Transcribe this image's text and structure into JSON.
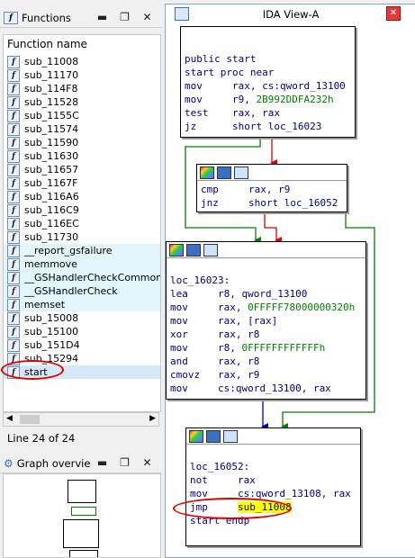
{
  "functions_panel": {
    "title": "Functions",
    "column_header": "Function name",
    "items": [
      {
        "name": "sub_11008",
        "library": false
      },
      {
        "name": "sub_11170",
        "library": false
      },
      {
        "name": "sub_114F8",
        "library": false
      },
      {
        "name": "sub_11528",
        "library": false
      },
      {
        "name": "sub_1155C",
        "library": false
      },
      {
        "name": "sub_11574",
        "library": false
      },
      {
        "name": "sub_11590",
        "library": false
      },
      {
        "name": "sub_11630",
        "library": false
      },
      {
        "name": "sub_11657",
        "library": false
      },
      {
        "name": "sub_1167F",
        "library": false
      },
      {
        "name": "sub_116A6",
        "library": false
      },
      {
        "name": "sub_116C9",
        "library": false
      },
      {
        "name": "sub_116EC",
        "library": false
      },
      {
        "name": "sub_11730",
        "library": false
      },
      {
        "name": "__report_gsfailure",
        "library": true
      },
      {
        "name": "memmove",
        "library": true
      },
      {
        "name": "__GSHandlerCheckCommon",
        "library": true
      },
      {
        "name": "__GSHandlerCheck",
        "library": true
      },
      {
        "name": "memset",
        "library": true
      },
      {
        "name": "sub_15008",
        "library": false
      },
      {
        "name": "sub_15100",
        "library": false
      },
      {
        "name": "sub_151D4",
        "library": false
      },
      {
        "name": "sub_15294",
        "library": false
      },
      {
        "name": "start",
        "library": false,
        "selected": true
      }
    ],
    "status": "Line 24 of 24"
  },
  "graph_overview": {
    "title": "Graph overvie"
  },
  "ida_view": {
    "title": "IDA View-A",
    "blocks": [
      {
        "lines": [
          [
            {
              "t": "public start"
            }
          ],
          [
            {
              "t": "start proc near"
            }
          ],
          [
            {
              "t": "mov     rax, cs:qword_13100"
            }
          ],
          [
            {
              "t": "mov     r9, "
            },
            {
              "t": "2B992DDFA232h",
              "c": "num"
            }
          ],
          [
            {
              "t": "test    rax, rax"
            }
          ],
          [
            {
              "t": "jz      short loc_16023"
            }
          ]
        ]
      },
      {
        "lines": [
          [
            {
              "t": "cmp     rax, r9"
            }
          ],
          [
            {
              "t": "jnz     short loc_16052"
            }
          ]
        ]
      },
      {
        "lines": [
          [
            {
              "t": ""
            }
          ],
          [
            {
              "t": "loc_16023:"
            }
          ],
          [
            {
              "t": "lea     r8, qword_13100"
            }
          ],
          [
            {
              "t": "mov     rax, "
            },
            {
              "t": "0FFFFF78000000320h",
              "c": "num"
            }
          ],
          [
            {
              "t": "mov     rax, [rax]"
            }
          ],
          [
            {
              "t": "xor     rax, r8"
            }
          ],
          [
            {
              "t": "mov     r8, "
            },
            {
              "t": "0FFFFFFFFFFFFh",
              "c": "num"
            }
          ],
          [
            {
              "t": "and     rax, r8"
            }
          ],
          [
            {
              "t": "cmovz   rax, r9"
            }
          ],
          [
            {
              "t": "mov     cs:qword_13100, rax"
            }
          ]
        ]
      },
      {
        "lines": [
          [
            {
              "t": ""
            }
          ],
          [
            {
              "t": "loc_16052:"
            }
          ],
          [
            {
              "t": "not     rax"
            }
          ],
          [
            {
              "t": "mov     cs:qword_13108, rax"
            }
          ],
          [
            {
              "t": "jmp     "
            },
            {
              "t": "sub_11008",
              "c": "hl"
            }
          ],
          [
            {
              "t": "start endp"
            }
          ]
        ]
      }
    ]
  },
  "colors": {
    "edge_true": "#008000",
    "edge_false": "#e00000",
    "edge_flow": "#0000c0",
    "annotation": "#e00000",
    "highlight": "#ffff00"
  }
}
